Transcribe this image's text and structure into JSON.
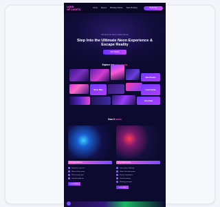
{
  "site": {
    "logo_lines": [
      "LAND",
      "OF LIGHTS"
    ],
    "nav_links": [
      "Home",
      "Rooms",
      "Birthday Parties",
      "Team Building"
    ],
    "nav_cta": "Book Now",
    "hero": {
      "eyebrow": "Immersive Neon Adventures",
      "title": "Step Into the Ultimate Neon Experience & Escape Reality",
      "cta": "Get Tickets"
    },
    "gallery_heading": {
      "main": "Explore our",
      "accent": "neon rooms"
    },
    "gallery_labels": [
      "Neon Rooms",
      "Mirror Maze",
      "Laser Games",
      "Glow Party"
    ],
    "features_heading": {
      "main": "How it",
      "accent": "works"
    },
    "features": [
      {
        "title": "Immersive Rooms",
        "items": [
          "Interactive neon art",
          "Mirror infinity rooms",
          "Photo-ready spots",
          "Family friendly fun"
        ],
        "button": "Learn More"
      },
      {
        "title": "Laser Experiences",
        "items": [
          "Laser maze challenge",
          "Glow in the dark games",
          "Group competitions",
          "Private bookings",
          "Birthday packages"
        ],
        "button": "Learn More"
      }
    ]
  },
  "colors": {
    "accent": "#ff3fa8",
    "primary": "#7b3cff",
    "background": "#0c0a2e"
  }
}
